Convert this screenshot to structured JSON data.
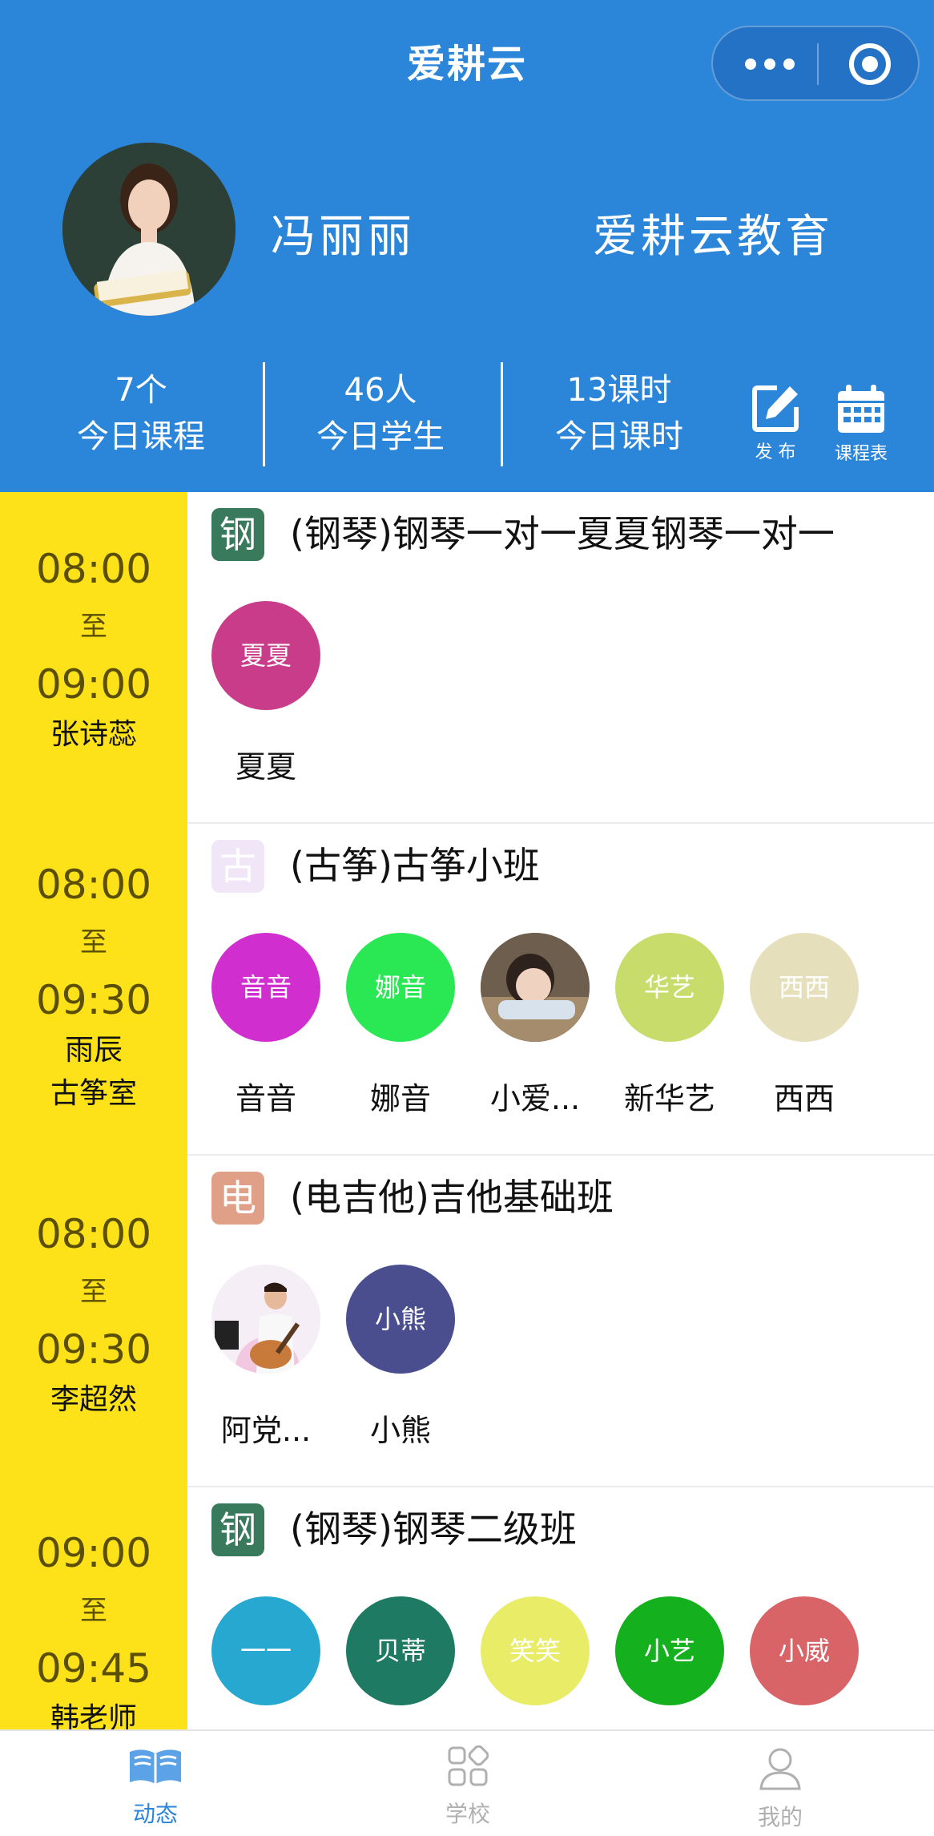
{
  "app": {
    "title": "爱耕云"
  },
  "profile": {
    "name": "冯丽丽",
    "org": "爱耕云教育"
  },
  "stats": [
    {
      "value": "7个",
      "label": "今日课程"
    },
    {
      "value": "46人",
      "label": "今日学生"
    },
    {
      "value": "13课时",
      "label": "今日课时"
    }
  ],
  "actions": {
    "publish": "发 布",
    "schedule": "课程表"
  },
  "courses": [
    {
      "start": "08:00",
      "to": "至",
      "end": "09:00",
      "teacher": "张诗蕊",
      "room": "",
      "badge": "钢",
      "badge_color": "#3a7a5c",
      "title": "(钢琴)钢琴一对一夏夏钢琴一对一",
      "students": [
        {
          "avatar": "夏夏",
          "name": "夏夏",
          "color": "#c83c8a"
        }
      ]
    },
    {
      "start": "08:00",
      "to": "至",
      "end": "09:30",
      "teacher": "雨辰",
      "room": "古筝室",
      "badge": "古",
      "badge_color": "#f1e6f8",
      "title": "(古筝)古筝小班",
      "students": [
        {
          "avatar": "音音",
          "name": "音音",
          "color": "#d12ed0"
        },
        {
          "avatar": "娜音",
          "name": "娜音",
          "color": "#29e854"
        },
        {
          "avatar": "",
          "name": "小爱...",
          "color": "#8a7a6a"
        },
        {
          "avatar": "华艺",
          "name": "新华艺",
          "color": "#c7dc6a"
        },
        {
          "avatar": "西西",
          "name": "西西",
          "color": "#e6dfbc"
        }
      ]
    },
    {
      "start": "08:00",
      "to": "至",
      "end": "09:30",
      "teacher": "李超然",
      "room": "",
      "badge": "电",
      "badge_color": "#e0a088",
      "title": "(电吉他)吉他基础班",
      "students": [
        {
          "avatar": "",
          "name": "阿党...",
          "color": "#f4eaf4"
        },
        {
          "avatar": "小熊",
          "name": "小熊",
          "color": "#4a4e8e"
        }
      ]
    },
    {
      "start": "09:00",
      "to": "至",
      "end": "09:45",
      "teacher": "韩老师",
      "room": "",
      "badge": "钢",
      "badge_color": "#3a7a5c",
      "title": "(钢琴)钢琴二级班",
      "students": [
        {
          "avatar": "一一",
          "name": "",
          "color": "#27a8d0"
        },
        {
          "avatar": "贝蒂",
          "name": "",
          "color": "#1e7a62"
        },
        {
          "avatar": "笑笑",
          "name": "",
          "color": "#e8ec66"
        },
        {
          "avatar": "小艺",
          "name": "",
          "color": "#15b01e"
        },
        {
          "avatar": "小威",
          "name": "",
          "color": "#d86468"
        }
      ]
    }
  ],
  "tabs": [
    {
      "label": "动态",
      "icon": "book-icon",
      "active": true
    },
    {
      "label": "学校",
      "icon": "grid-icon",
      "active": false
    },
    {
      "label": "我的",
      "icon": "person-icon",
      "active": false
    }
  ],
  "colors": {
    "header": "#2b85d9",
    "time_column": "#fde219",
    "tab_active": "#2b85d9",
    "tab_inactive": "#b0b0b0"
  }
}
